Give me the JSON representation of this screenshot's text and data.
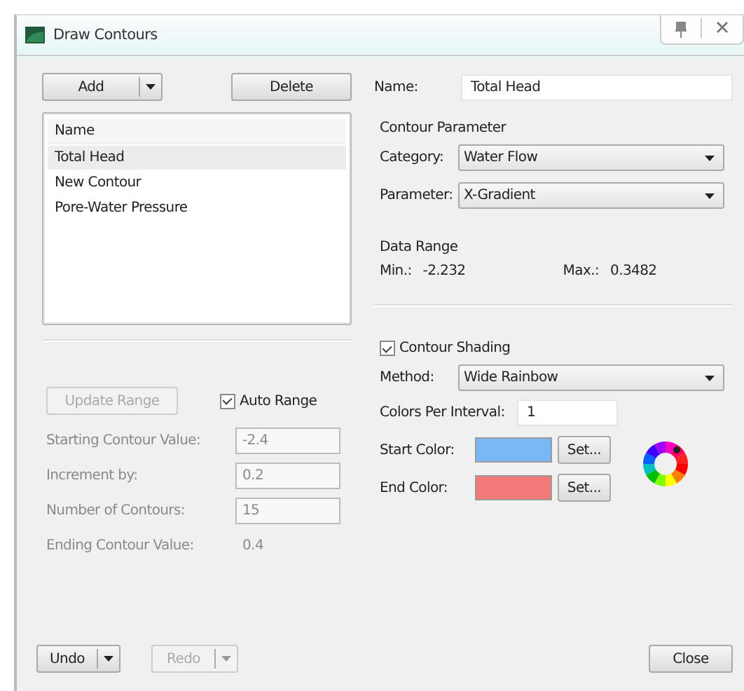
{
  "window": {
    "title": "Draw Contours"
  },
  "list_toolbar": {
    "add_button": "Add",
    "delete_button": "Delete"
  },
  "contour_list": {
    "header": "Name",
    "items": [
      {
        "label": "Total Head",
        "selected": true
      },
      {
        "label": "New Contour",
        "selected": false
      },
      {
        "label": "Pore-Water Pressure",
        "selected": false
      }
    ]
  },
  "range": {
    "update_button": {
      "label": "Update Range",
      "disabled": true
    },
    "auto_range": {
      "label": "Auto Range",
      "checked": true
    },
    "fields": [
      {
        "kind": "field",
        "label": "Starting Contour Value:",
        "value": "-2.4",
        "disabled": true
      },
      {
        "kind": "field",
        "label": "Increment by:",
        "value": "0.2",
        "disabled": true
      },
      {
        "kind": "field",
        "label": "Number of Contours:",
        "value": "15",
        "disabled": true
      },
      {
        "kind": "text",
        "label": "Ending Contour Value:",
        "value": "0.4",
        "disabled": true
      }
    ]
  },
  "name": {
    "label": "Name:",
    "value": "Total Head"
  },
  "contour_parameter": {
    "title": "Contour Parameter",
    "dropdowns": [
      {
        "label": "Category:",
        "value": "Water Flow"
      },
      {
        "label": "Parameter:",
        "value": "X-Gradient"
      }
    ]
  },
  "data_range": {
    "title": "Data Range",
    "min_label": "Min.:",
    "min": "-2.232",
    "max_label": "Max.:",
    "max": "0.3482"
  },
  "shading": {
    "label": "Contour Shading",
    "checked": true,
    "method": {
      "label": "Method:",
      "value": "Wide Rainbow"
    },
    "colors_per_interval": {
      "label": "Colors Per Interval:",
      "value": "1"
    },
    "colors": [
      {
        "label": "Start Color:",
        "color": "#7ab8f5",
        "button": "Set..."
      },
      {
        "label": "End Color:",
        "color": "#f47a7a",
        "button": "Set..."
      }
    ]
  },
  "footer": {
    "undo": {
      "label": "Undo",
      "disabled": false
    },
    "redo": {
      "label": "Redo",
      "disabled": true
    },
    "close": "Close"
  }
}
